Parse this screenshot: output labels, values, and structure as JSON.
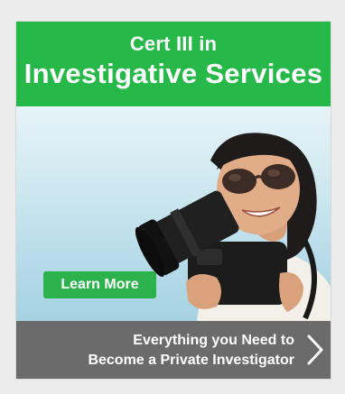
{
  "ad": {
    "heading_line1": "Cert III in",
    "heading_line2": "Investigative Services",
    "cta_label": "Learn More",
    "footer_line1": "Everything you Need to",
    "footer_line2": "Become a Private Investigator",
    "chevron_icon": "chevron-right-icon"
  },
  "colors": {
    "brand_green": "#27b84a",
    "footer_gray": "#6b6b6b",
    "background": "#ececec"
  }
}
